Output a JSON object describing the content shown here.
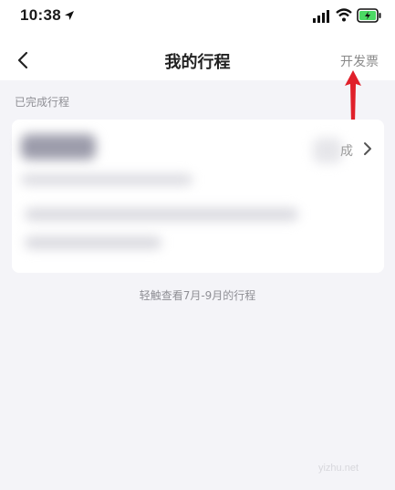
{
  "status_bar": {
    "time": "10:38"
  },
  "nav": {
    "title": "我的行程",
    "invoice_label": "开发票"
  },
  "sections": {
    "completed_label": "已完成行程"
  },
  "trip_card": {
    "status_text": "成"
  },
  "footer": {
    "history_link": "轻触查看7月-9月的行程"
  },
  "watermark": "yizhu.net",
  "colors": {
    "annotation_arrow": "#e0202a",
    "background": "#f4f4f8",
    "battery_fill": "#4cd964"
  }
}
